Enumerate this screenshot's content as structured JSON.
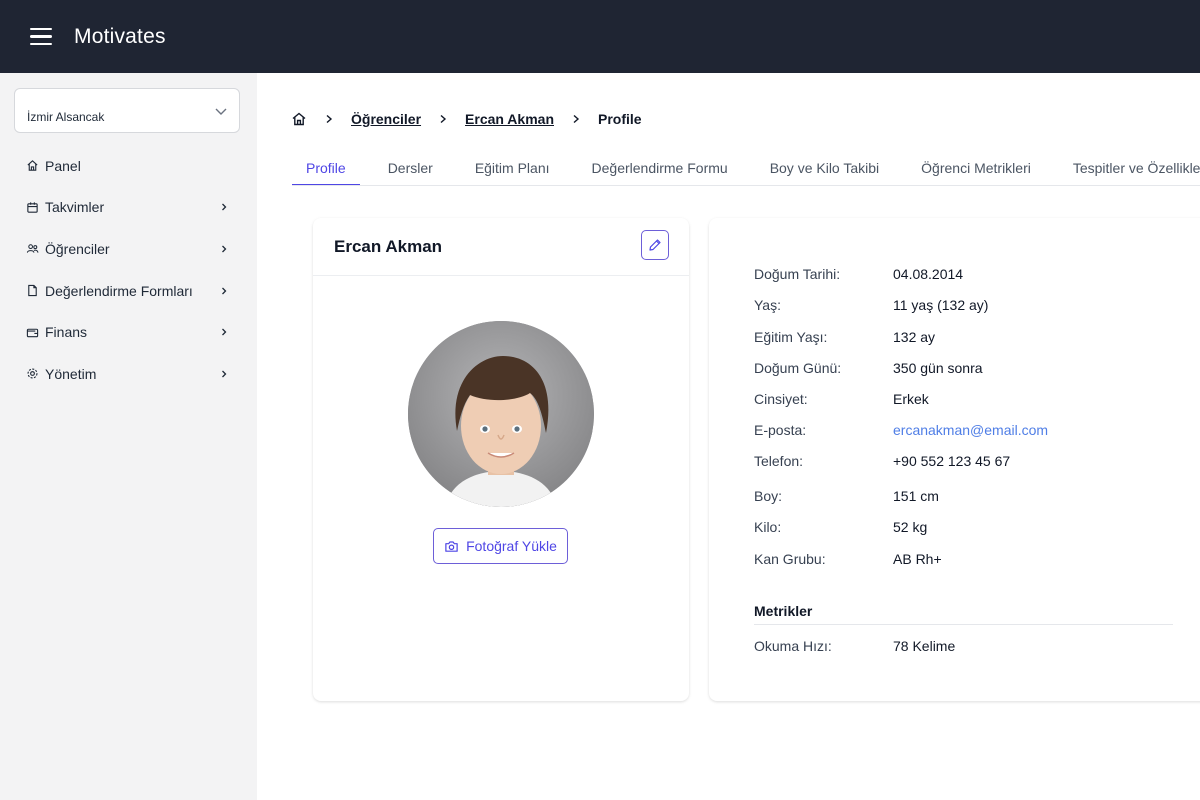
{
  "app": {
    "title": "Motivates"
  },
  "sidebar": {
    "branch": "İzmir Alsancak",
    "items": [
      {
        "label": "Panel",
        "icon": "home-icon",
        "has_children": false
      },
      {
        "label": "Takvimler",
        "icon": "calendar-icon",
        "has_children": true
      },
      {
        "label": "Öğrenciler",
        "icon": "users-icon",
        "has_children": true
      },
      {
        "label": "Değerlendirme Formları",
        "icon": "file-icon",
        "has_children": true
      },
      {
        "label": "Finans",
        "icon": "wallet-icon",
        "has_children": true
      },
      {
        "label": "Yönetim",
        "icon": "gear-icon",
        "has_children": true
      }
    ]
  },
  "breadcrumb": {
    "home_icon": "home-icon",
    "items": [
      "Öğrenciler",
      "Ercan Akman"
    ],
    "current": "Profile"
  },
  "tabs": [
    {
      "label": "Profile",
      "active": true
    },
    {
      "label": "Dersler",
      "active": false
    },
    {
      "label": "Eğitim Planı",
      "active": false
    },
    {
      "label": "Değerlendirme Formu",
      "active": false
    },
    {
      "label": "Boy ve Kilo Takibi",
      "active": false
    },
    {
      "label": "Öğrenci Metrikleri",
      "active": false
    },
    {
      "label": "Tespitler ve Özellikler",
      "active": false
    }
  ],
  "profile_card": {
    "name": "Ercan Akman",
    "edit_icon": "pencil-icon",
    "upload_label": "Fotoğraf Yükle",
    "upload_icon": "camera-icon"
  },
  "details": {
    "rows": [
      {
        "label": "Doğum Tarihi:",
        "value": "04.08.2014"
      },
      {
        "label": "Yaş:",
        "value": "11 yaş (132 ay)"
      },
      {
        "label": "Eğitim Yaşı:",
        "value": "132 ay"
      },
      {
        "label": "Doğum Günü:",
        "value": "350 gün sonra"
      },
      {
        "label": "Cinsiyet:",
        "value": "Erkek"
      },
      {
        "label": "E-posta:",
        "value": "ercanakman@email.com"
      },
      {
        "label": "Telefon:",
        "value": "+90 552 123 45 67"
      },
      {
        "label": "Boy:",
        "value": "151 cm"
      },
      {
        "label": "Kilo:",
        "value": "52 kg"
      },
      {
        "label": "Kan Grubu:",
        "value": "AB Rh+"
      }
    ],
    "metrics_title": "Metrikler",
    "metrics": [
      {
        "label": "Okuma Hızı:",
        "value": "78 Kelime"
      }
    ]
  },
  "colors": {
    "topbar": "#1f2533",
    "sidebar": "#f3f3f4",
    "accent": "#4f46e5",
    "link": "#4f7ee6"
  }
}
